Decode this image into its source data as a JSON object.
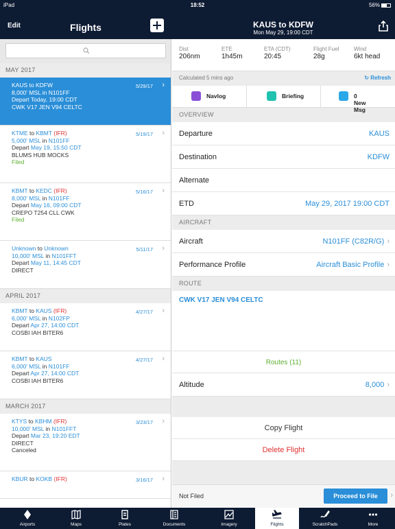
{
  "status": {
    "device": "iPad",
    "time": "18:52",
    "battery": "56%"
  },
  "left_nav": {
    "edit_label": "Edit",
    "title": "Flights"
  },
  "right_nav": {
    "title": "KAUS to KDFW",
    "subtitle": "Mon May 29, 19:00 CDT"
  },
  "flight_list": {
    "sections": [
      {
        "header": "MAY 2017",
        "flights": [
          {
            "from": "KAUS",
            "to": "KDFW",
            "ifr": "",
            "date": "5/29/17",
            "alt": "8,000' MSL",
            "aircraft": "N101FF",
            "depart_label": "Depart",
            "depart": "Today, 19:00 CDT",
            "route": "CWK V17 JEN V94 CELTC",
            "status": ""
          },
          {
            "from": "KTME",
            "to": "KBMT",
            "ifr": "(IFR)",
            "date": "5/19/17",
            "alt": "5,000' MSL",
            "aircraft": "N101FF",
            "depart_label": "Depart",
            "depart": "May 19, 15:50 CDT",
            "route": "BLUMS HUB MOCKS",
            "status": "Filed"
          },
          {
            "from": "KBMT",
            "to": "KEDC",
            "ifr": "(IFR)",
            "date": "5/16/17",
            "alt": "8,000' MSL",
            "aircraft": "N101FF",
            "depart_label": "Depart",
            "depart": "May 16, 09:00 CDT",
            "route": "CREPO T254 CLL CWK",
            "status": "Filed"
          },
          {
            "from": "Unknown",
            "to": "Unknown",
            "ifr": "",
            "date": "5/11/17",
            "alt": "10,000' MSL",
            "aircraft": "N101FFT",
            "depart_label": "Depart",
            "depart": "May 11, 14:45 CDT",
            "route": "DIRECT",
            "status": ""
          }
        ]
      },
      {
        "header": "APRIL 2017",
        "flights": [
          {
            "from": "KBMT",
            "to": "KAUS",
            "ifr": "(IFR)",
            "date": "4/27/17",
            "alt": "6,000' MSL",
            "aircraft": "N102FP",
            "depart_label": "Depart",
            "depart": "Apr 27, 14:00 CDT",
            "route": "COSBI IAH BITER6",
            "status": ""
          },
          {
            "from": "KBMT",
            "to": "KAUS",
            "ifr": "",
            "date": "4/27/17",
            "alt": "6,000' MSL",
            "aircraft": "N101FF",
            "depart_label": "Depart",
            "depart": "Apr 27, 14:00 CDT",
            "route": "COSBI IAH BITER6",
            "status": ""
          }
        ]
      },
      {
        "header": "MARCH 2017",
        "flights": [
          {
            "from": "KTYS",
            "to": "KBHM",
            "ifr": "(IFR)",
            "date": "3/23/17",
            "alt": "10,000' MSL",
            "aircraft": "N101FFT",
            "depart_label": "Depart",
            "depart": "Mar 23, 19:20 EDT",
            "route": "DIRECT",
            "status": "Canceled"
          },
          {
            "from": "KBUR",
            "to": "KOKB",
            "ifr": "(IFR)",
            "date": "3/16/17",
            "alt": "",
            "aircraft": "",
            "depart_label": "",
            "depart": "",
            "route": "",
            "status": ""
          }
        ]
      }
    ]
  },
  "stats": [
    {
      "label": "Dist",
      "value": "206nm"
    },
    {
      "label": "ETE",
      "value": "1h45m"
    },
    {
      "label": "ETA (CDT)",
      "value": "20:45"
    },
    {
      "label": "Flight Fuel",
      "value": "28g"
    },
    {
      "label": "Wind",
      "value": "6kt head"
    }
  ],
  "calc_bar": {
    "text": "Calculated 5 mins ago",
    "refresh": "Refresh"
  },
  "quick_buttons": {
    "navlog": "Navlog",
    "briefing": "Briefing",
    "messages": "0 New Msg"
  },
  "overview": {
    "header": "OVERVIEW",
    "departure_label": "Departure",
    "departure": "KAUS",
    "destination_label": "Destination",
    "destination": "KDFW",
    "alternate_label": "Alternate",
    "etd_label": "ETD",
    "etd": "May 29, 2017 19:00 CDT"
  },
  "aircraft_section": {
    "header": "AIRCRAFT",
    "aircraft_label": "Aircraft",
    "aircraft": "N101FF (C82R/G)",
    "profile_label": "Performance Profile",
    "profile": "Aircraft Basic Profile"
  },
  "route_section": {
    "header": "ROUTE",
    "route": "CWK V17 JEN V94 CELTC",
    "routes_link": "Routes (11)",
    "altitude_label": "Altitude",
    "altitude": "8,000"
  },
  "actions": {
    "copy": "Copy Flight",
    "delete": "Delete Flight"
  },
  "bottom": {
    "filing_status": "Not Filed",
    "proceed": "Proceed to File"
  },
  "tabs": [
    {
      "label": "Airports",
      "icon": "airport-icon"
    },
    {
      "label": "Maps",
      "icon": "map-icon"
    },
    {
      "label": "Plates",
      "icon": "plates-icon"
    },
    {
      "label": "Documents",
      "icon": "documents-icon"
    },
    {
      "label": "Imagery",
      "icon": "imagery-icon"
    },
    {
      "label": "Flights",
      "icon": "airplane-icon"
    },
    {
      "label": "ScratchPads",
      "icon": "scratchpad-icon"
    },
    {
      "label": "More",
      "icon": "more-icon"
    }
  ],
  "colors": {
    "navy": "#0d1b33",
    "accent_blue": "#2a8ed8",
    "ifr_red": "#e03030",
    "filed_green": "#5cb030",
    "delete_red": "#e03030",
    "navlog_purple": "#8a4fd6",
    "briefing_teal": "#1fc3b0",
    "msg_blue": "#2aa8e8"
  }
}
